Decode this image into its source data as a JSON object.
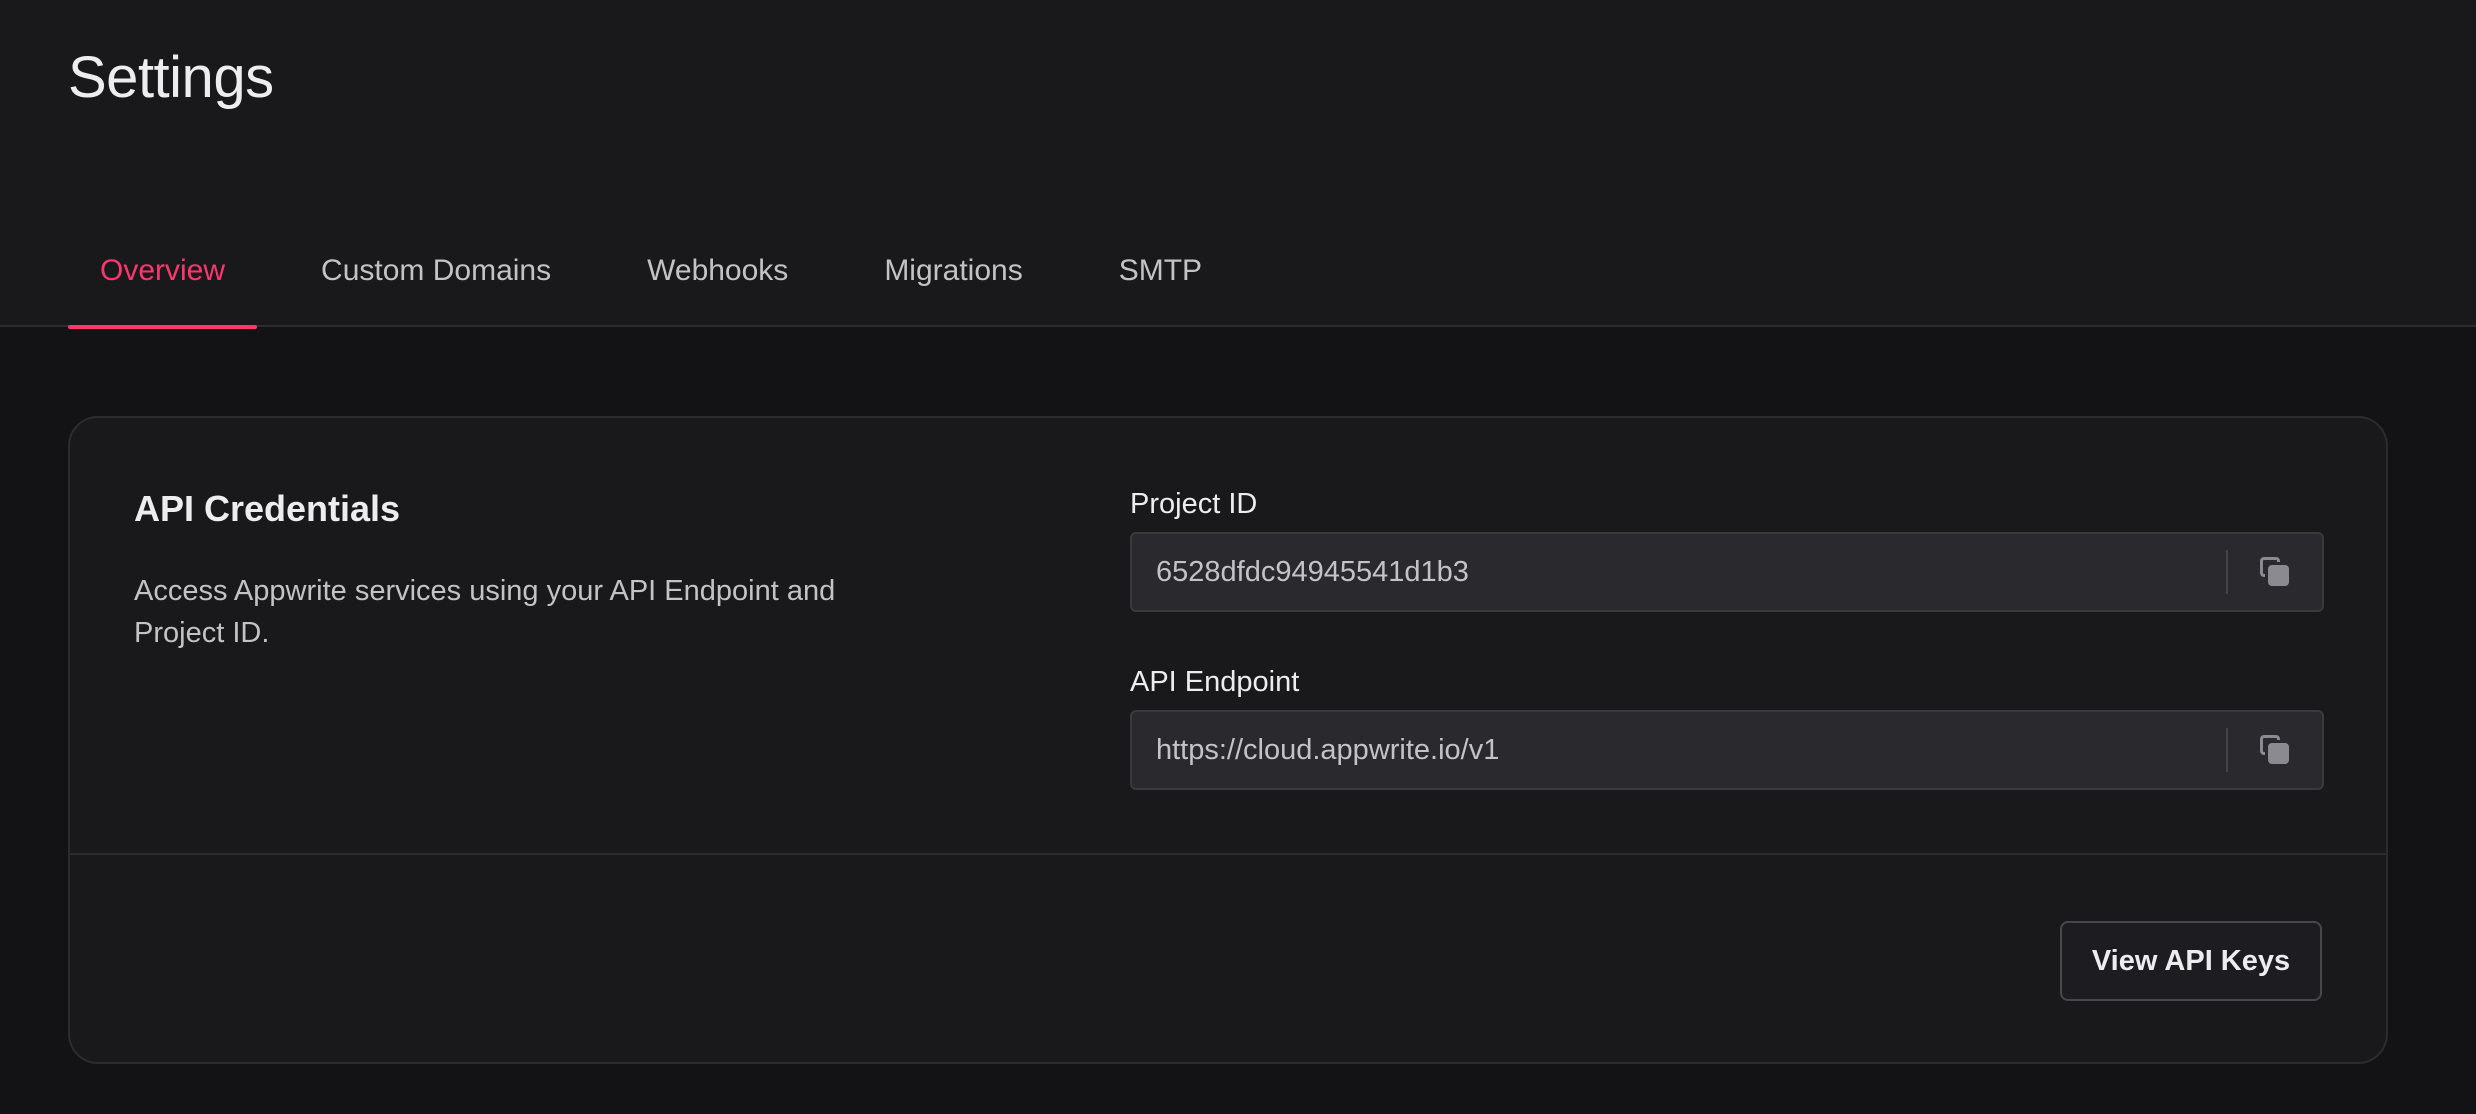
{
  "header": {
    "title": "Settings"
  },
  "tabs": [
    {
      "label": "Overview",
      "active": true
    },
    {
      "label": "Custom Domains",
      "active": false
    },
    {
      "label": "Webhooks",
      "active": false
    },
    {
      "label": "Migrations",
      "active": false
    },
    {
      "label": "SMTP",
      "active": false
    }
  ],
  "credentials": {
    "heading": "API Credentials",
    "description": "Access Appwrite services using your API Endpoint and Project ID.",
    "project_id": {
      "label": "Project ID",
      "value": "6528dfdc94945541d1b3",
      "icon": "copy-icon"
    },
    "api_endpoint": {
      "label": "API Endpoint",
      "value": "https://cloud.appwrite.io/v1",
      "icon": "copy-icon"
    },
    "view_keys_label": "View API Keys"
  },
  "colors": {
    "accent": "#fd366e",
    "background": "#131315",
    "surface": "#19191c"
  }
}
